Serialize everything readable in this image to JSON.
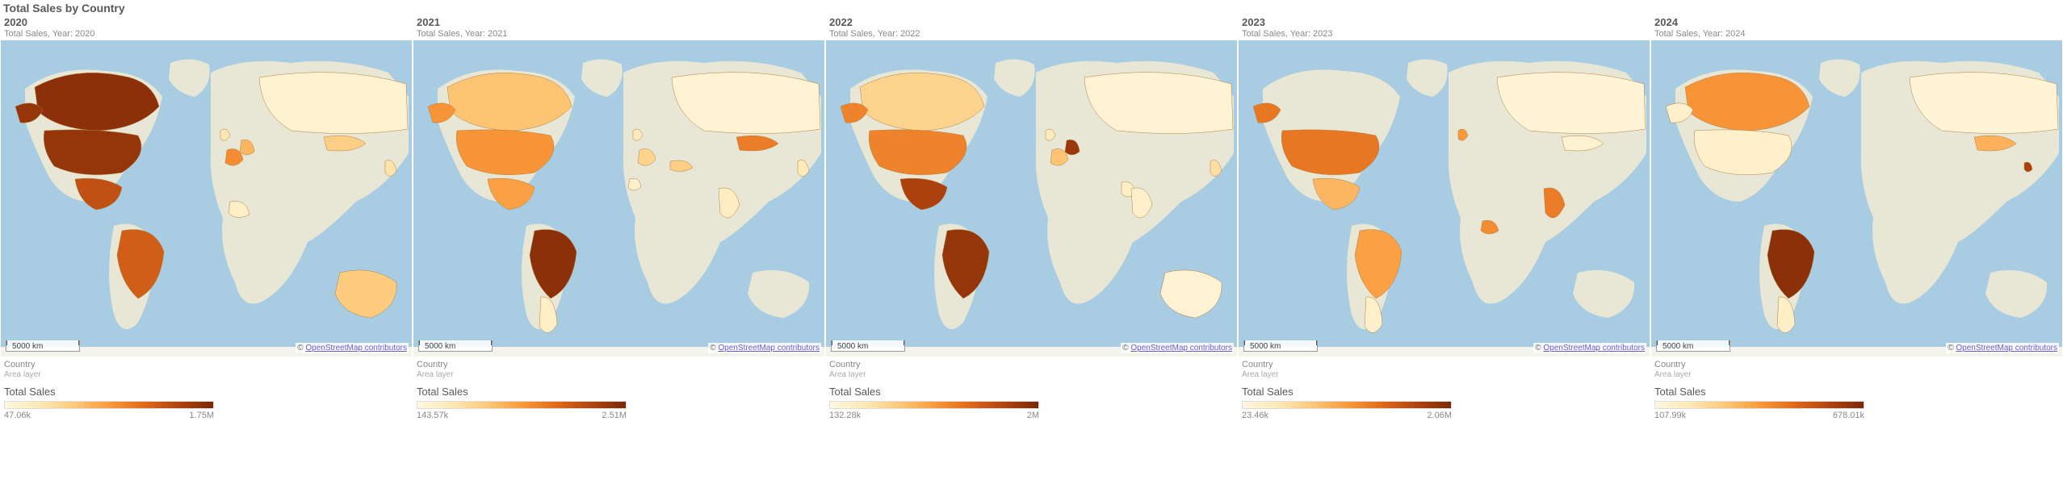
{
  "main_title": "Total Sales by Country",
  "scale_label": "5000 km",
  "attribution_prefix": "© ",
  "attribution_link": "OpenStreetMap contributors",
  "legend_dimension": "Country",
  "legend_layer": "Area layer",
  "legend_metric": "Total Sales",
  "chart_data": [
    {
      "type": "choropleth-map",
      "year_title": "2020",
      "subtitle": "Total Sales, Year: 2020",
      "legend_min": "47.06k",
      "legend_max": "1.75M",
      "countries": {
        "Canada": {
          "intensity": 0.95
        },
        "United States": {
          "intensity": 0.92
        },
        "Mexico": {
          "intensity": 0.78
        },
        "Brazil": {
          "intensity": 0.72
        },
        "Australia": {
          "intensity": 0.32
        },
        "Mongolia": {
          "intensity": 0.3
        },
        "France": {
          "intensity": 0.55
        },
        "Germany": {
          "intensity": 0.4
        },
        "Russia": {
          "intensity": 0.06
        },
        "Mali": {
          "intensity": 0.1
        },
        "United Kingdom": {
          "intensity": 0.18
        },
        "Japan": {
          "intensity": 0.2
        }
      }
    },
    {
      "type": "choropleth-map",
      "year_title": "2021",
      "subtitle": "Total Sales, Year: 2021",
      "legend_min": "143.57k",
      "legend_max": "2.51M",
      "countries": {
        "Canada": {
          "intensity": 0.35
        },
        "United States": {
          "intensity": 0.52
        },
        "Mexico": {
          "intensity": 0.48
        },
        "Brazil": {
          "intensity": 0.95
        },
        "Argentina": {
          "intensity": 0.1
        },
        "France": {
          "intensity": 0.28
        },
        "United Kingdom": {
          "intensity": 0.15
        },
        "Morocco": {
          "intensity": 0.08
        },
        "Turkey": {
          "intensity": 0.3
        },
        "Russia": {
          "intensity": 0.05
        },
        "Japan": {
          "intensity": 0.15
        },
        "Mongolia": {
          "intensity": 0.6
        },
        "India": {
          "intensity": 0.12
        }
      }
    },
    {
      "type": "choropleth-map",
      "year_title": "2022",
      "subtitle": "Total Sales, Year: 2022",
      "legend_min": "132.28k",
      "legend_max": "2M",
      "countries": {
        "Canada": {
          "intensity": 0.28
        },
        "United States": {
          "intensity": 0.58
        },
        "Mexico": {
          "intensity": 0.85
        },
        "Brazil": {
          "intensity": 0.92
        },
        "Australia": {
          "intensity": 0.05
        },
        "United Kingdom": {
          "intensity": 0.15
        },
        "France": {
          "intensity": 0.35
        },
        "Germany": {
          "intensity": 0.9
        },
        "Russia": {
          "intensity": 0.05
        },
        "Pakistan": {
          "intensity": 0.1
        },
        "India": {
          "intensity": 0.08
        },
        "Japan": {
          "intensity": 0.22
        }
      }
    },
    {
      "type": "choropleth-map",
      "year_title": "2023",
      "subtitle": "Total Sales, Year: 2023",
      "legend_min": "23.46k",
      "legend_max": "2.06M",
      "countries": {
        "United States": {
          "intensity": 0.62
        },
        "Mexico": {
          "intensity": 0.4
        },
        "Brazil": {
          "intensity": 0.48
        },
        "Argentina": {
          "intensity": 0.08
        },
        "Nigeria": {
          "intensity": 0.55
        },
        "India": {
          "intensity": 0.6
        },
        "Mongolia": {
          "intensity": 0.06
        },
        "United Kingdom": {
          "intensity": 0.5
        },
        "Russia": {
          "intensity": 0.04
        }
      }
    },
    {
      "type": "choropleth-map",
      "year_title": "2024",
      "subtitle": "Total Sales, Year: 2024",
      "legend_min": "107.99k",
      "legend_max": "678.01k",
      "countries": {
        "Canada": {
          "intensity": 0.52
        },
        "United States": {
          "intensity": 0.08
        },
        "Brazil": {
          "intensity": 0.95
        },
        "Argentina": {
          "intensity": 0.1
        },
        "Mongolia": {
          "intensity": 0.42
        },
        "South Korea": {
          "intensity": 0.85
        },
        "Russia": {
          "intensity": 0.04
        }
      }
    }
  ]
}
